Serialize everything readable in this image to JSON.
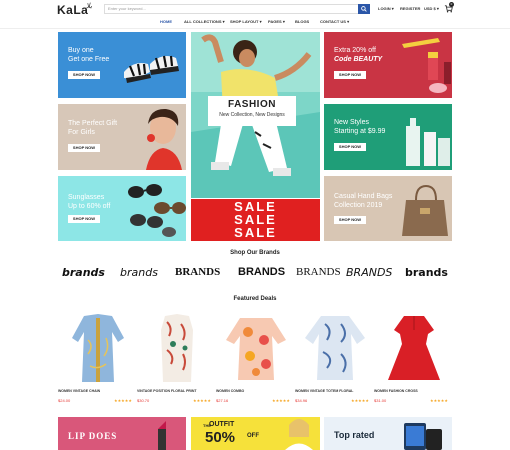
{
  "header": {
    "logo": "KaLa",
    "logo_mark": "بلا",
    "search_placeholder": "Enter your keyword...",
    "login": "LOGIN",
    "register": "REGISTER",
    "currency": "USD $",
    "cart_count": "0"
  },
  "nav": {
    "items": [
      {
        "label": "HOME"
      },
      {
        "label": "ALL COLLECTIONS"
      },
      {
        "label": "SHOP LAYOUT"
      },
      {
        "label": "PAGES"
      },
      {
        "label": "BLOGS"
      },
      {
        "label": "CONTACT US"
      }
    ]
  },
  "banners": {
    "sandals": {
      "line1": "Buy one",
      "line2": "Get one Free",
      "button": "SHOP NOW"
    },
    "gift": {
      "line1": "The Perfect Gift",
      "line2": "For Girls",
      "button": "SHOP NOW"
    },
    "sunglasses": {
      "line1": "Sunglasses",
      "line2": "Up to 60% off",
      "button": "SHOP NOW"
    },
    "center": {
      "title": "FASHION",
      "subtitle": "New Collection, New Designs"
    },
    "sale": {
      "text": "SALE"
    },
    "beauty": {
      "line1": "Extra 20% off",
      "line2": "Code BEAUTY",
      "button": "SHOP NOW"
    },
    "styles": {
      "line1": "New Styles",
      "line2": "Starting at $9.99",
      "button": "SHOP NOW"
    },
    "bags": {
      "line1": "Casual Hand Bags",
      "line2": "Collection 2019",
      "button": "SHOP NOW"
    }
  },
  "brands": {
    "title": "Shop Our Brands",
    "items": [
      "brands",
      "brands",
      "BRANDS",
      "BRANDS",
      "BRANDS",
      "BRANDS",
      "brands"
    ]
  },
  "featured": {
    "title": "Featured Deals",
    "products": [
      {
        "name": "WOMEN VINTAGE CHAIN",
        "price": "$24.00",
        "stars": "★★★★★"
      },
      {
        "name": "VINTAGE POSITION FLORAL PRINT",
        "price": "$30.70",
        "stars": "★★★★★"
      },
      {
        "name": "WOMEN COMBO",
        "price": "$27.16",
        "stars": "★★★★★"
      },
      {
        "name": "WOMEN VINTAGE TOTEM FLORAL",
        "price": "$34.96",
        "stars": "★★★★★"
      },
      {
        "name": "WOMEN FASHION CROSS",
        "price": "$31.00",
        "stars": "★★★★★"
      }
    ]
  },
  "bottom": {
    "lip": "LIP DOES",
    "outfit_pre": "THE",
    "outfit": "OUTFIT",
    "outfit_pct": "50%",
    "outfit_off": "OFF",
    "top_rated": "Top rated"
  },
  "colors": {
    "accent": "#2b56a8",
    "sale_red": "#e02020",
    "price_red": "#e53935"
  }
}
